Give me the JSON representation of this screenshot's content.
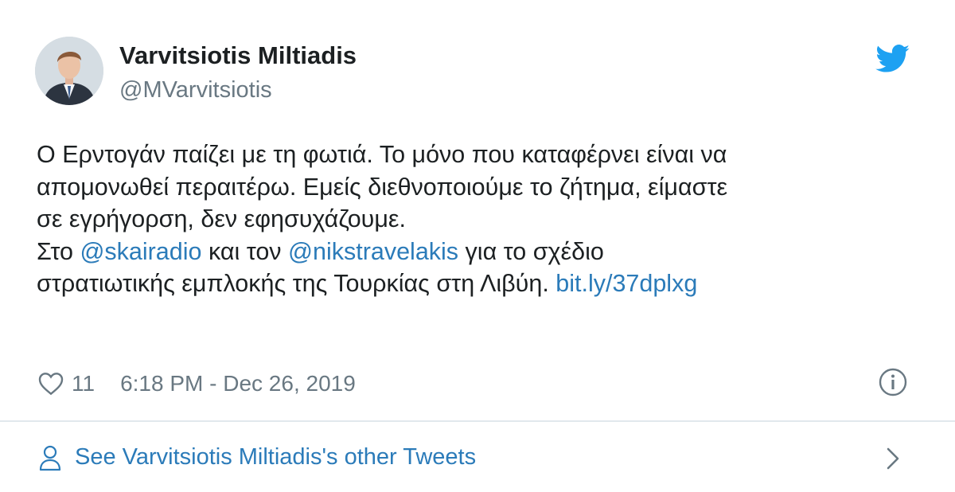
{
  "author": {
    "name": "Varvitsiotis Miltiadis",
    "handle": "@MVarvitsiotis",
    "avatar_icon": "profile-photo"
  },
  "tweet": {
    "line1": "Ο Ερντογάν παίζει με τη φωτιά. Το μόνο που καταφέρνει είναι να",
    "line2": "απομονωθεί περαιτέρω. Εμείς διεθνοποιούμε το ζήτημα, είμαστε",
    "line3": "σε εγρήγορση, δεν εφησυχάζουμε.",
    "line4_prefix": "Στο ",
    "mention1": "@skairadio",
    "line4_middle": " και τον ",
    "mention2": "@nikstravelakis",
    "line4_suffix": " για το σχέδιο",
    "line5_prefix": "στρατιωτικής εμπλοκής της Τουρκίας στη Λιβύη. ",
    "url": "bit.ly/37dplxg"
  },
  "meta": {
    "likes": "11",
    "timestamp": "6:18 PM - Dec 26, 2019"
  },
  "footer": {
    "label": "See Varvitsiotis Miltiadis's other Tweets"
  },
  "colors": {
    "link": "#2b7bb9",
    "twitter_blue": "#1da1f2",
    "muted": "#697882",
    "text": "#1c2022",
    "divider": "#e1e8ed"
  },
  "icons": [
    "twitter-bird-icon",
    "heart-icon",
    "info-icon",
    "person-icon",
    "chevron-right-icon"
  ]
}
